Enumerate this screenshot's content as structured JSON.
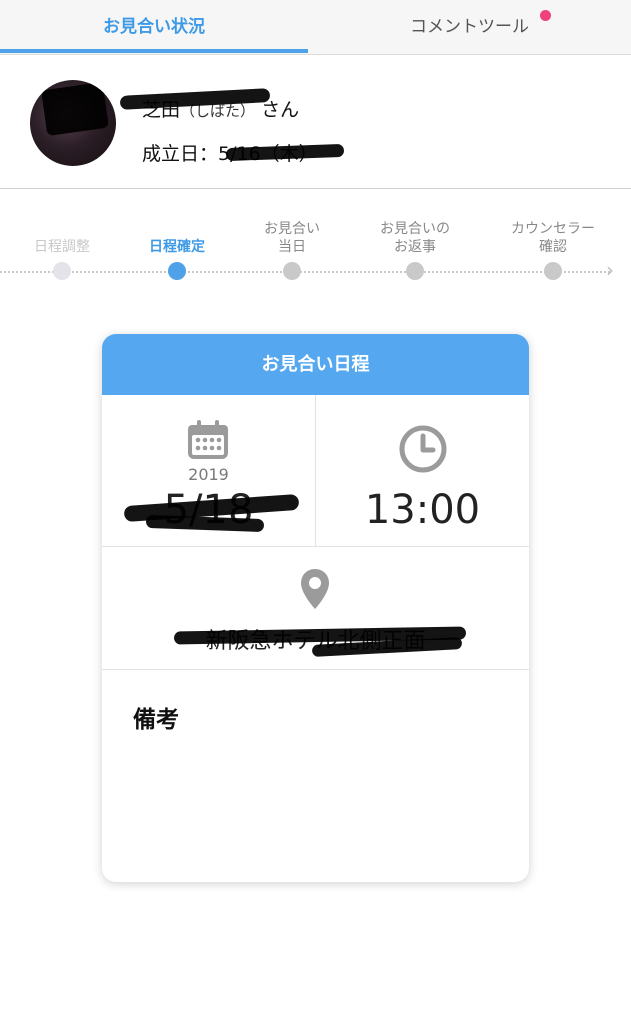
{
  "tabs": [
    {
      "label": "お見合い状況",
      "active": true
    },
    {
      "label": "コメントツール",
      "active": false,
      "has_notification": true
    }
  ],
  "colors": {
    "accent": "#4fa1ea",
    "notification": "#f0427a",
    "inactive_dot": "#c9c9c9"
  },
  "profile": {
    "name": "芝田",
    "name_kana": "（しばた）",
    "honorific": "さん",
    "established_label": "成立日：",
    "established_value": "5/16（木）"
  },
  "steps": [
    {
      "label_line1": "日程調整",
      "label_line2": "",
      "state": "done"
    },
    {
      "label_line1": "日程確定",
      "label_line2": "",
      "state": "active"
    },
    {
      "label_line1": "お見合い",
      "label_line2": "当日",
      "state": "upcoming"
    },
    {
      "label_line1": "お見合いの",
      "label_line2": "お返事",
      "state": "upcoming"
    },
    {
      "label_line1": "カウンセラー",
      "label_line2": "確認",
      "state": "upcoming"
    }
  ],
  "schedule": {
    "title": "お見合い日程",
    "year": "2019",
    "date": "5/18",
    "time": "13:00",
    "place": "新阪急ホテル北側正面",
    "notes_label": "備考",
    "notes": "",
    "icons": {
      "date": "calendar-icon",
      "time": "clock-icon",
      "place": "map-pin-icon"
    }
  }
}
